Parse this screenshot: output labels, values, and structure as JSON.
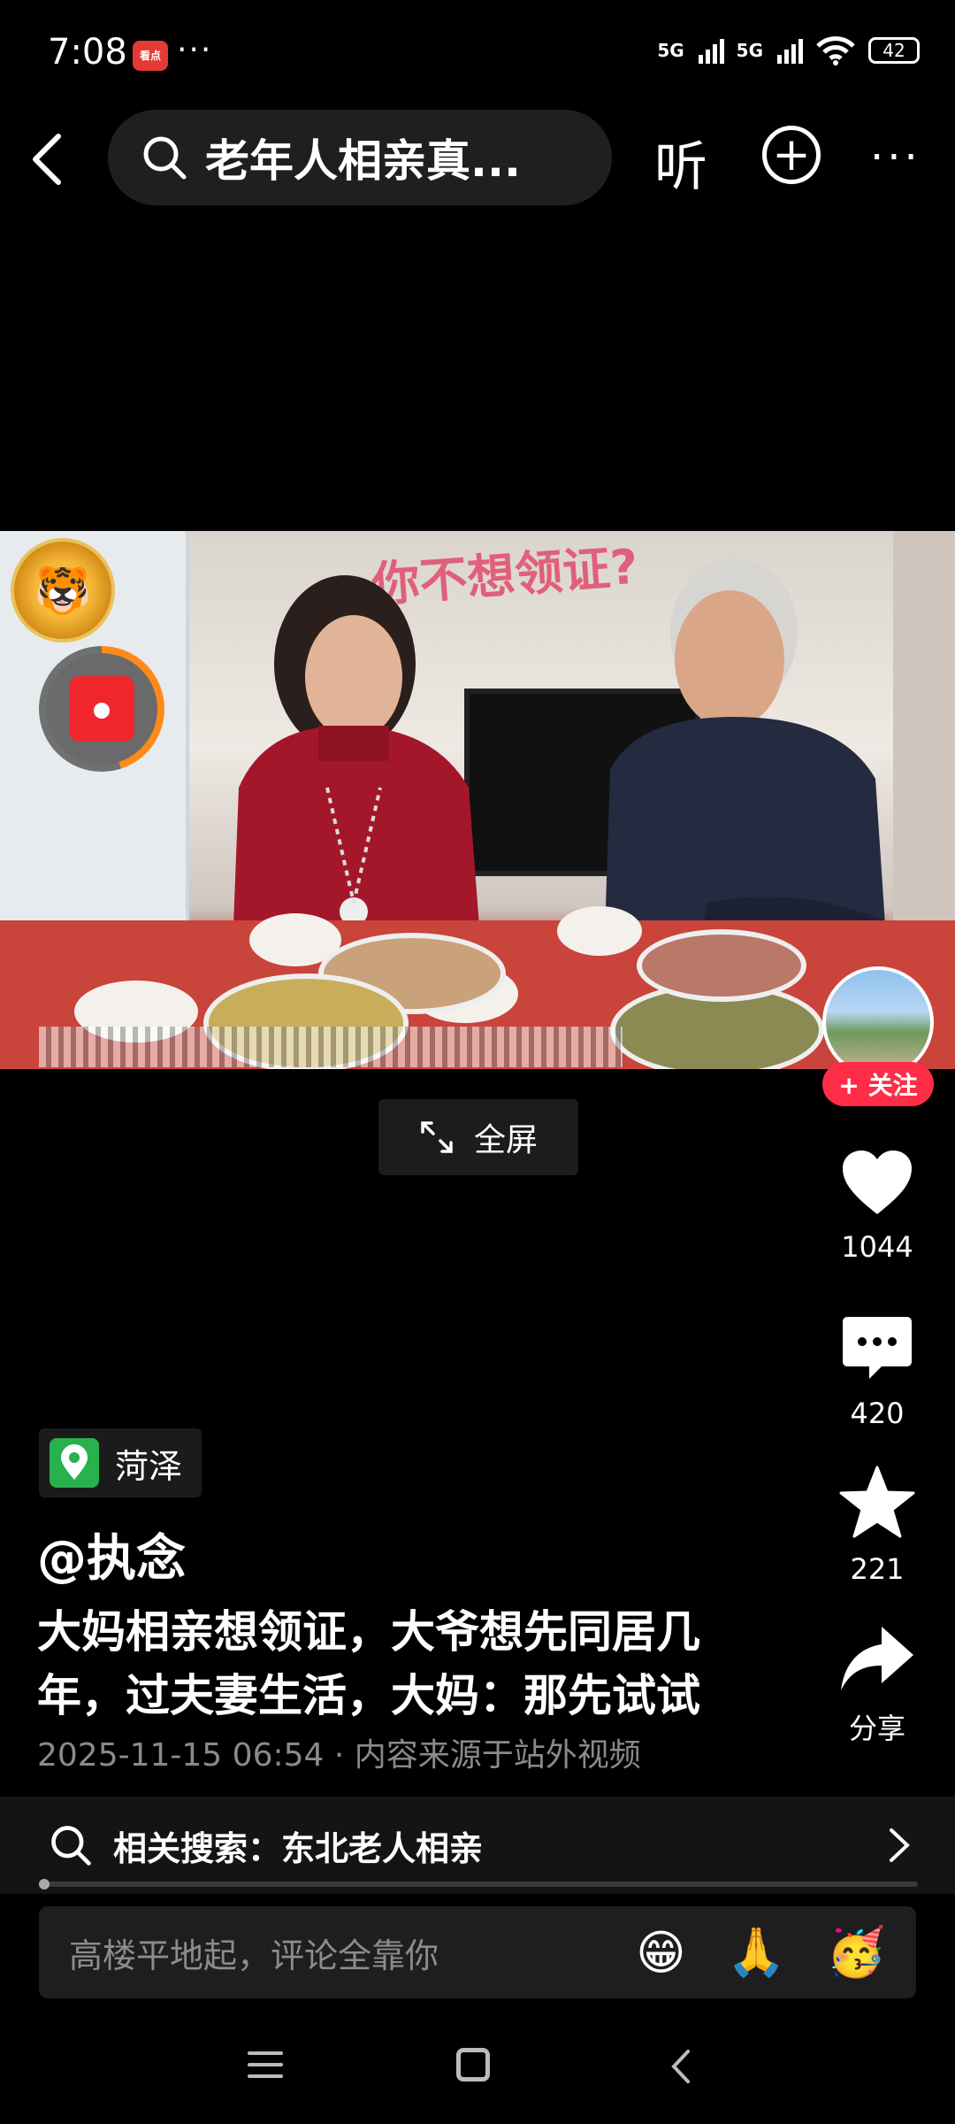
{
  "status_bar": {
    "time": "7:08",
    "app_icon_label": "看点",
    "more": "···",
    "network_1": "5G",
    "network_2": "5G",
    "battery": "42"
  },
  "top_nav": {
    "search_query": "老年人相亲真...",
    "listen_label": "听",
    "add_label": "+",
    "more_label": "···"
  },
  "video": {
    "banner_text": "你不想领证?",
    "fullscreen_label": "全屏"
  },
  "side_actions": {
    "follow_label": "+ 关注",
    "like_count": "1044",
    "comment_count": "420",
    "favorite_count": "221",
    "share_label": "分享"
  },
  "post": {
    "location": "菏泽",
    "author": "@执念",
    "caption": "大妈相亲想领证，大爷想先同居几年，过夫妻生活，大妈：那先试试",
    "date": "2025-11-15 06:54",
    "source": " · 内容来源于站外视频"
  },
  "related_search": {
    "prefix": "相关搜索：",
    "term": "东北老人相亲"
  },
  "comment_bar": {
    "placeholder": "高楼平地起，评论全靠你",
    "emojis": [
      "😁",
      "🙏",
      "🥳"
    ]
  },
  "colors": {
    "accent_red": "#ff2d47",
    "location_green": "#28b14c",
    "redpacket_ring": "#ff8a1a"
  }
}
